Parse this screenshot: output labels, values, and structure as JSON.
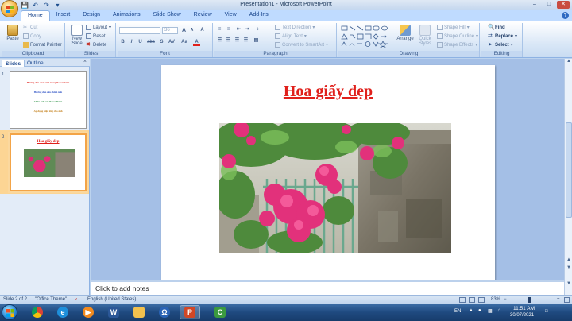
{
  "window": {
    "title": "Presentation1 - Microsoft PowerPoint"
  },
  "tabs": [
    "Home",
    "Insert",
    "Design",
    "Animations",
    "Slide Show",
    "Review",
    "View",
    "Add-Ins"
  ],
  "ribbon": {
    "clipboard": {
      "label": "Clipboard",
      "paste": "Paste",
      "cut": "Cut",
      "copy": "Copy",
      "format_painter": "Format Painter"
    },
    "slides": {
      "label": "Slides",
      "new_slide": "New Slide",
      "layout": "Layout",
      "reset": "Reset",
      "delete": "Delete"
    },
    "font": {
      "label": "Font",
      "font_size": "36",
      "bold": "B",
      "italic": "I",
      "underline": "U",
      "strike": "abc",
      "shadow": "S",
      "spacing": "AV",
      "case": "Aa",
      "grow": "A",
      "shrink": "A",
      "clear": "A"
    },
    "paragraph": {
      "label": "Paragraph",
      "text_direction": "Text Direction",
      "align_text": "Align Text",
      "smartart": "Convert to SmartArt"
    },
    "drawing": {
      "label": "Drawing",
      "arrange": "Arrange",
      "quick_styles": "Quick Styles",
      "shape_fill": "Shape Fill",
      "shape_outline": "Shape Outline",
      "shape_effects": "Shape Effects"
    },
    "editing": {
      "label": "Editing",
      "find": "Find",
      "replace": "Replace",
      "select": "Select"
    }
  },
  "left_panel": {
    "tab_slides": "Slides",
    "tab_outline": "Outline",
    "close": "×",
    "slides": [
      {
        "number": "1",
        "lines": [
          {
            "text": "Hướng dẫn chèn ảnh trong PowerPoint",
            "color": "#e0201b"
          },
          {
            "text": "Hướng dẫn căn chỉnh ảnh",
            "color": "#2a4fc4"
          },
          {
            "text": "Chèn ảnh vào PowerPoint",
            "color": "#1f8a3a"
          },
          {
            "text": "Áp dụng hiệu ứng cho ảnh",
            "color": "#c4801c"
          }
        ]
      },
      {
        "number": "2",
        "title": "Hoa giấy đẹp"
      }
    ]
  },
  "slide": {
    "title": "Hoa giấy đẹp",
    "title_color": "#e0201b"
  },
  "notes_placeholder": "Click to add notes",
  "status": {
    "slide_info": "Slide 2 of 2",
    "theme": "\"Office Theme\"",
    "language": "English (United States)",
    "zoom": "83%"
  },
  "taskbar": {
    "language": "EN",
    "time": "11:51 AM",
    "date": "30/07/2021"
  }
}
